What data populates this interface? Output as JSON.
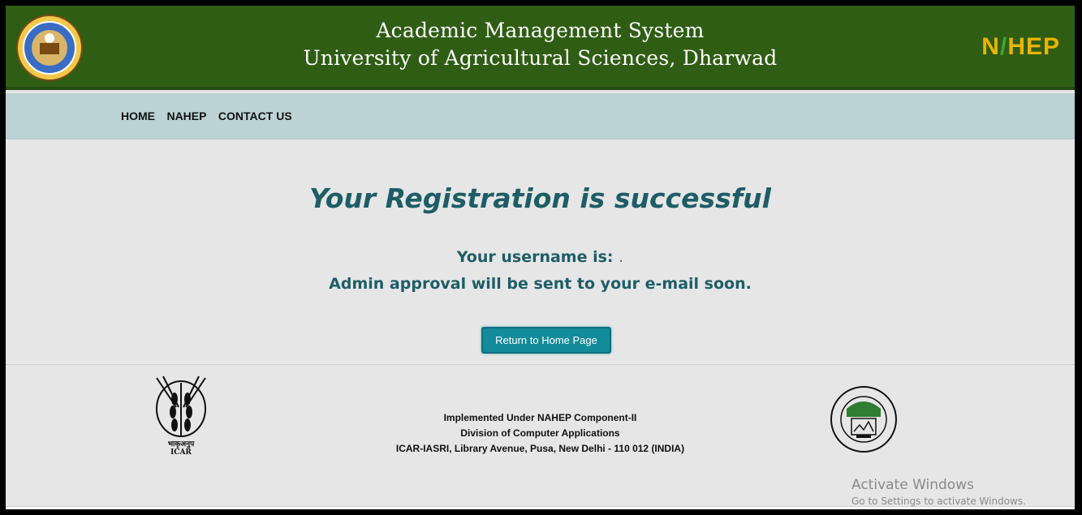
{
  "header": {
    "title_line1": "Academic Management System",
    "title_line2": "University of Agricultural Sciences, Dharwad",
    "nahep_logo_left": "N",
    "nahep_logo_right": "HEP",
    "logo_icons": [
      "university-seal-icon",
      "nahep-logo"
    ]
  },
  "nav": {
    "items": [
      {
        "label": "HOME"
      },
      {
        "label": "NAHEP"
      },
      {
        "label": "CONTACT US"
      }
    ]
  },
  "main": {
    "heading": "Your Registration is successful",
    "username_label": "Your username is:",
    "username_value": ".",
    "approval_message": "Admin approval will be sent to your e-mail soon.",
    "return_button": "Return to Home Page"
  },
  "footer": {
    "line1": "Implemented Under NAHEP Component-II",
    "line2": "Division of Computer Applications",
    "line3": "ICAR-IASRI, Library Avenue, Pusa, New Delhi - 110 012 (INDIA)",
    "icar_logo_text": "भाकृअनुप",
    "icar_logo_abbr": "ICAR"
  },
  "watermark": {
    "line1": "Activate Windows",
    "line2": "Go to Settings to activate Windows."
  },
  "colors": {
    "header_bg": "#2f5d14",
    "nav_bg": "#bcd3d6",
    "heading": "#1e5d66",
    "button": "#138b9a"
  }
}
